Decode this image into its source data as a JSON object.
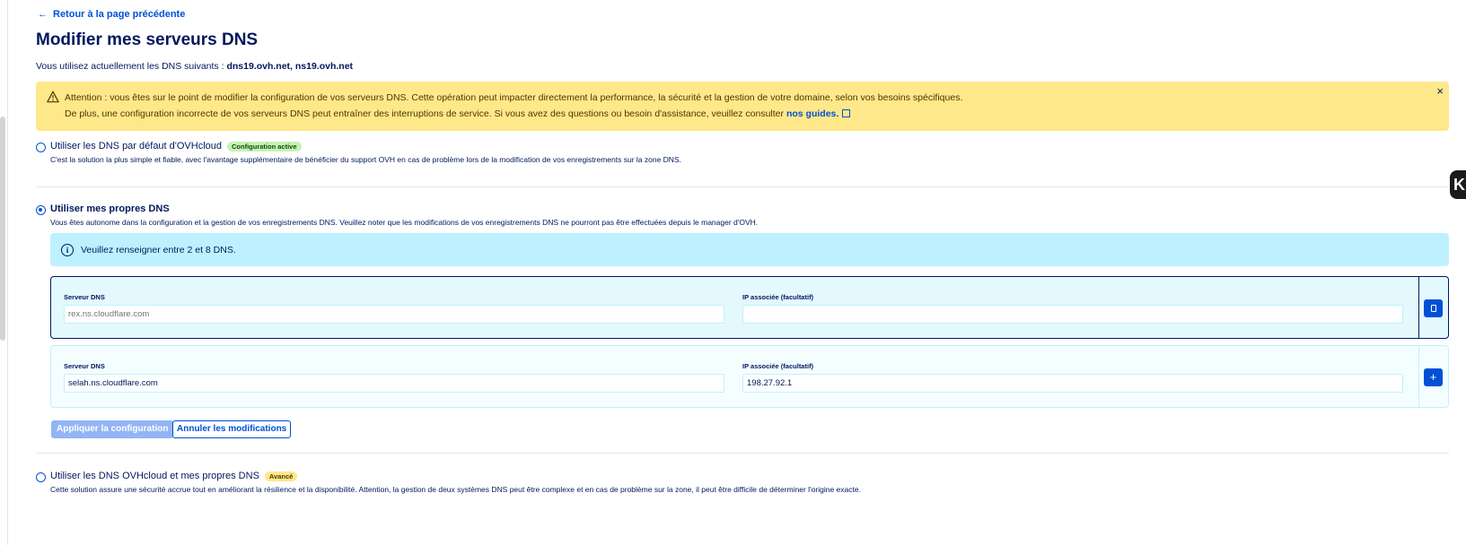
{
  "back_link": "Retour à la page précédente",
  "page_title": "Modifier mes serveurs DNS",
  "current_dns": {
    "prefix": "Vous utilisez actuellement les DNS suivants :",
    "servers": "dns19.ovh.net, ns19.ovh.net"
  },
  "warning": {
    "line1": "Attention : vous êtes sur le point de modifier la configuration de vos serveurs DNS. Cette opération peut impacter directement la performance, la sécurité et la gestion de votre domaine, selon vos besoins spécifiques.",
    "line2": "De plus, une configuration incorrecte de vos serveurs DNS peut entraîner des interruptions de service. Si vous avez des questions ou besoin d'assistance, veuillez consulter",
    "link": "nos guides.",
    "close": "×"
  },
  "options": [
    {
      "title": "Utiliser les DNS par défaut d'OVHcloud",
      "badge": "Configuration active",
      "description": "C'est la solution la plus simple et fiable, avec l'avantage supplémentaire de bénéficier du support OVH en cas de problème lors de la modification de vos enregistrements sur la zone DNS.",
      "selected": false
    },
    {
      "title": "Utiliser mes propres DNS",
      "badge": "",
      "description": "Vous êtes autonome dans la configuration et la gestion de vos enregistrements DNS. Veuillez noter que les modifications de vos enregistrements DNS ne pourront pas être effectuées depuis le manager d'OVH.",
      "selected": true
    },
    {
      "title": "Utiliser les DNS OVHcloud et mes propres DNS",
      "badge": "Avancé",
      "description": "Cette solution assure une sécurité accrue tout en améliorant la résilience et la disponibilité. Attention, la gestion de deux systèmes DNS peut être complexe et en cas de problème sur la zone, il peut être difficile de déterminer l'origine exacte.",
      "selected": false
    }
  ],
  "info_message": "Veuillez renseigner entre 2 et 8 DNS.",
  "dns_rows": [
    {
      "server_label": "Serveur DNS",
      "server_value": "",
      "server_placeholder": "rex.ns.cloudflare.com",
      "ip_label": "IP associée (facultatif)",
      "ip_value": "",
      "action": "delete"
    },
    {
      "server_label": "Serveur DNS",
      "server_value": "selah.ns.cloudflare.com",
      "server_placeholder": "",
      "ip_label": "IP associée (facultatif)",
      "ip_value": "198.27.92.1",
      "action": "add"
    }
  ],
  "buttons": {
    "apply": "Appliquer la configuration",
    "cancel": "Annuler les modifications"
  },
  "colors": {
    "primary": "#0050d7",
    "text": "#00185e",
    "warning_bg": "#ffe889",
    "info_bg": "#bef1ff",
    "badge_active": "#c6f1b8"
  },
  "icons": {
    "back": "arrow-left-icon",
    "warning": "warning-triangle-icon",
    "close": "close-icon",
    "external": "external-link-icon",
    "info": "info-circle-icon",
    "delete": "trash-icon",
    "add": "plus-icon"
  }
}
